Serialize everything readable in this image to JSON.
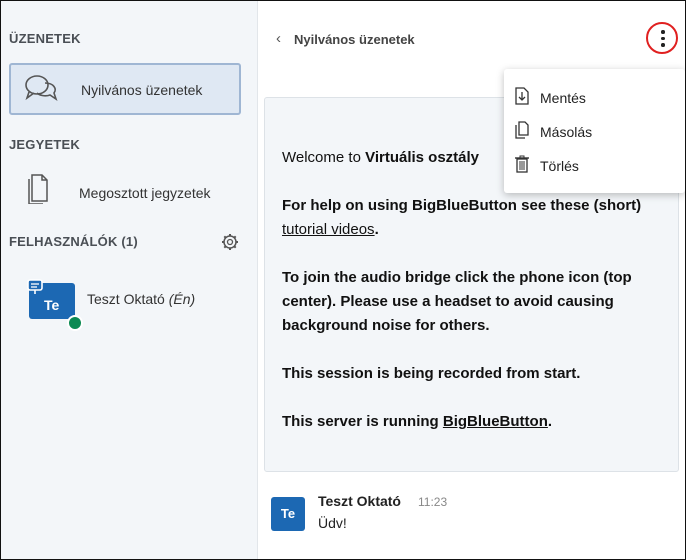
{
  "sidebar": {
    "messages_title": "ÜZENETEK",
    "public_chat_label": "Nyilvános üzenetek",
    "notes_title": "JEGYETEK",
    "shared_notes_label": "Megosztott jegyzetek",
    "users_title": "FELHASZNÁLÓK (1)",
    "user": {
      "initials": "Te",
      "name": "Teszt Oktató",
      "self_tag": "(Én)"
    }
  },
  "chat": {
    "back_chevron": "‹",
    "title": "Nyilvános üzenetek",
    "welcome": {
      "l1_a": "Welcome to ",
      "l1_b": "Virtuális osztály",
      "l2_a": "For help on using BigBlueButton see these (short) ",
      "l2_link": "tutorial videos",
      "l2_b": ".",
      "l3_a": "To join the audio bridge click the phone icon (top center). ",
      "l3_b": "Please use a headset to avoid causing background noise for others.",
      "l4": "This session is being recorded from start.",
      "l5_a": "This server is running ",
      "l5_link": "BigBlueButton",
      "l5_b": "."
    },
    "message": {
      "initials": "Te",
      "author": "Teszt Oktató",
      "time": "11:23",
      "text": "Üdv!"
    }
  },
  "menu": {
    "save_label": "Mentés",
    "copy_label": "Másolás",
    "delete_label": "Törlés"
  },
  "colors": {
    "avatar_blue": "#1c68b3",
    "headset_green": "#0c8a53",
    "highlight_ring": "#e02020",
    "sidebar_bg": "#f3f6f9",
    "selected_item_bg": "#dfe8f3"
  },
  "icons": {
    "public_chat": "speech-bubbles-icon",
    "shared_notes": "document-icon",
    "settings": "gear-icon",
    "presenter": "presenter-screen-icon",
    "audio": "headset-icon",
    "more": "vertical-dots-icon",
    "save": "download-file-icon",
    "copy": "copy-icon",
    "delete": "trash-icon"
  }
}
